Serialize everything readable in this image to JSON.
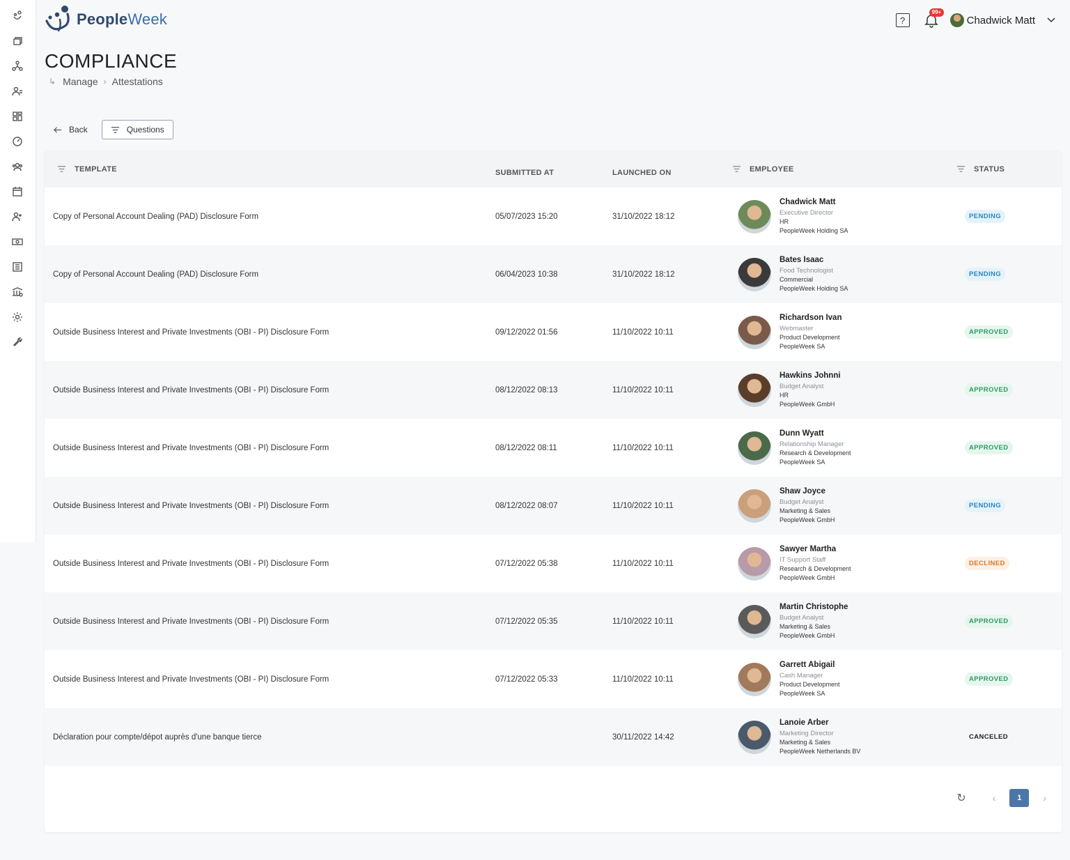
{
  "brand": {
    "people": "People",
    "week": "Week"
  },
  "header": {
    "help_label": "?",
    "notification_badge": "99+",
    "user_name": "Chadwick Matt"
  },
  "page": {
    "title": "COMPLIANCE"
  },
  "breadcrumb": {
    "items": [
      "Manage",
      "Attestations"
    ]
  },
  "toolbar": {
    "back_label": "Back",
    "questions_label": "Questions"
  },
  "table": {
    "columns": {
      "template": "TEMPLATE",
      "submitted_at": "SUBMITTED AT",
      "launched_on": "LAUNCHED ON",
      "employee": "EMPLOYEE",
      "status": "STATUS"
    },
    "rows": [
      {
        "template": "Copy of Personal Account Dealing (PAD) Disclosure Form",
        "submitted": "05/07/2023 15:20",
        "launched": "31/10/2022 18:12",
        "name": "Chadwick Matt",
        "position": "Executive Director",
        "department": "HR",
        "company": "PeopleWeek Holding SA",
        "status": "PENDING",
        "status_type": "pending",
        "avatar_color": "#6d8a5a"
      },
      {
        "template": "Copy of Personal Account Dealing (PAD) Disclosure Form",
        "submitted": "06/04/2023 10:38",
        "launched": "31/10/2022 18:12",
        "name": "Bates Isaac",
        "position": "Food Technologist",
        "department": "Commercial",
        "company": "PeopleWeek Holding SA",
        "status": "PENDING",
        "status_type": "pending",
        "avatar_color": "#3a3a3a"
      },
      {
        "template": "Outside Business Interest and Private Investments (OBI - PI) Disclosure Form",
        "submitted": "09/12/2022 01:56",
        "launched": "11/10/2022 10:11",
        "name": "Richardson Ivan",
        "position": "Webmaster",
        "department": "Product Development",
        "company": "PeopleWeek SA",
        "status": "APPROVED",
        "status_type": "approved",
        "avatar_color": "#7a5a4a"
      },
      {
        "template": "Outside Business Interest and Private Investments (OBI - PI) Disclosure Form",
        "submitted": "08/12/2022 08:13",
        "launched": "11/10/2022 10:11",
        "name": "Hawkins Johnni",
        "position": "Budget Analyst",
        "department": "HR",
        "company": "PeopleWeek GmbH",
        "status": "APPROVED",
        "status_type": "approved",
        "avatar_color": "#5a3e2a"
      },
      {
        "template": "Outside Business Interest and Private Investments (OBI - PI) Disclosure Form",
        "submitted": "08/12/2022 08:11",
        "launched": "11/10/2022 10:11",
        "name": "Dunn Wyatt",
        "position": "Relationship Manager",
        "department": "Research & Development",
        "company": "PeopleWeek SA",
        "status": "APPROVED",
        "status_type": "approved",
        "avatar_color": "#4a6a4a"
      },
      {
        "template": "Outside Business Interest and Private Investments (OBI - PI) Disclosure Form",
        "submitted": "08/12/2022 08:07",
        "launched": "11/10/2022 10:11",
        "name": "Shaw Joyce",
        "position": "Budget Analyst",
        "department": "Marketing & Sales",
        "company": "PeopleWeek GmbH",
        "status": "PENDING",
        "status_type": "pending",
        "avatar_color": "#c9a07a"
      },
      {
        "template": "Outside Business Interest and Private Investments (OBI - PI) Disclosure Form",
        "submitted": "07/12/2022 05:38",
        "launched": "11/10/2022 10:11",
        "name": "Sawyer Martha",
        "position": "IT Support Staff",
        "department": "Research & Development",
        "company": "PeopleWeek GmbH",
        "status": "DECLINED",
        "status_type": "declined",
        "avatar_color": "#b89aa8"
      },
      {
        "template": "Outside Business Interest and Private Investments (OBI - PI) Disclosure Form",
        "submitted": "07/12/2022 05:35",
        "launched": "11/10/2022 10:11",
        "name": "Martin Christophe",
        "position": "Budget Analyst",
        "department": "Marketing & Sales",
        "company": "PeopleWeek GmbH",
        "status": "APPROVED",
        "status_type": "approved",
        "avatar_color": "#5a5a5a"
      },
      {
        "template": "Outside Business Interest and Private Investments (OBI - PI) Disclosure Form",
        "submitted": "07/12/2022 05:33",
        "launched": "11/10/2022 10:11",
        "name": "Garrett Abigail",
        "position": "Cash Manager",
        "department": "Product Development",
        "company": "PeopleWeek SA",
        "status": "APPROVED",
        "status_type": "approved",
        "avatar_color": "#a07a5a"
      },
      {
        "template": "Déclaration pour compte/dépot auprès d'une banque tierce",
        "submitted": "",
        "launched": "30/11/2022 14:42",
        "name": "Lanoie Arber",
        "position": "Marketing Director",
        "department": "Marketing & Sales",
        "company": "PeopleWeek Netherlands BV",
        "status": "CANCELED",
        "status_type": "canceled",
        "avatar_color": "#4a5a6a"
      }
    ]
  },
  "pagination": {
    "current_page": "1",
    "prev": "‹",
    "next": "›",
    "refresh": "↻"
  }
}
